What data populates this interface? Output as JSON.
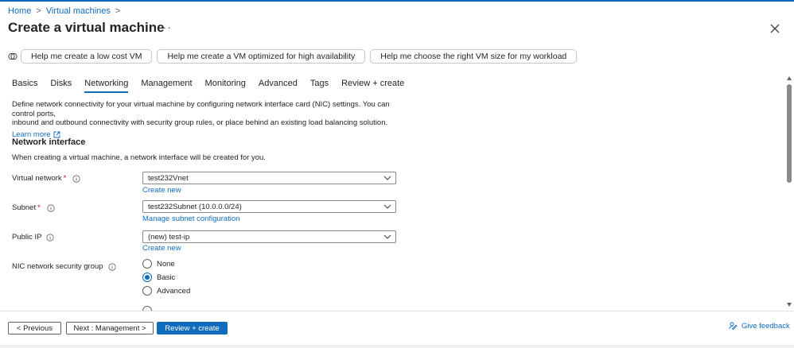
{
  "breadcrumb": {
    "home": "Home",
    "virtual_machines": "Virtual machines",
    "sep": ">"
  },
  "title": "Create a virtual machine",
  "more": "···",
  "copilot": {
    "icon": "copilot-icon",
    "suggestions": [
      "Help me create a low cost VM",
      "Help me create a VM optimized for high availability",
      "Help me choose the right VM size for my workload"
    ]
  },
  "tabs": [
    "Basics",
    "Disks",
    "Networking",
    "Management",
    "Monitoring",
    "Advanced",
    "Tags",
    "Review + create"
  ],
  "active_tab": "Networking",
  "intro": {
    "line1": "Define network connectivity for your virtual machine by configuring network interface card (NIC) settings. You can control ports,",
    "line2": "inbound and outbound connectivity with security group rules, or place behind an existing load balancing solution.",
    "learn_more": "Learn more"
  },
  "network_interface": {
    "heading": "Network interface",
    "description": "When creating a virtual machine, a network interface will be created for you."
  },
  "fields": {
    "virtual_network": {
      "label": "Virtual network",
      "required": "*",
      "value": "test232Vnet",
      "link": "Create new"
    },
    "subnet": {
      "label": "Subnet",
      "required": "*",
      "value": "test232Subnet (10.0.0.0/24)",
      "link": "Manage subnet configuration"
    },
    "public_ip": {
      "label": "Public IP",
      "value": "(new) test-ip",
      "link": "Create new"
    },
    "nic_nsg": {
      "label": "NIC network security group",
      "options": [
        "None",
        "Basic",
        "Advanced"
      ],
      "selected": "Basic"
    }
  },
  "footer": {
    "previous": "< Previous",
    "next": "Next : Management >",
    "review": "Review + create",
    "feedback": "Give feedback"
  },
  "colors": {
    "accent": "#0f6cbd",
    "required": "#c50f1f",
    "text": "#242424"
  }
}
